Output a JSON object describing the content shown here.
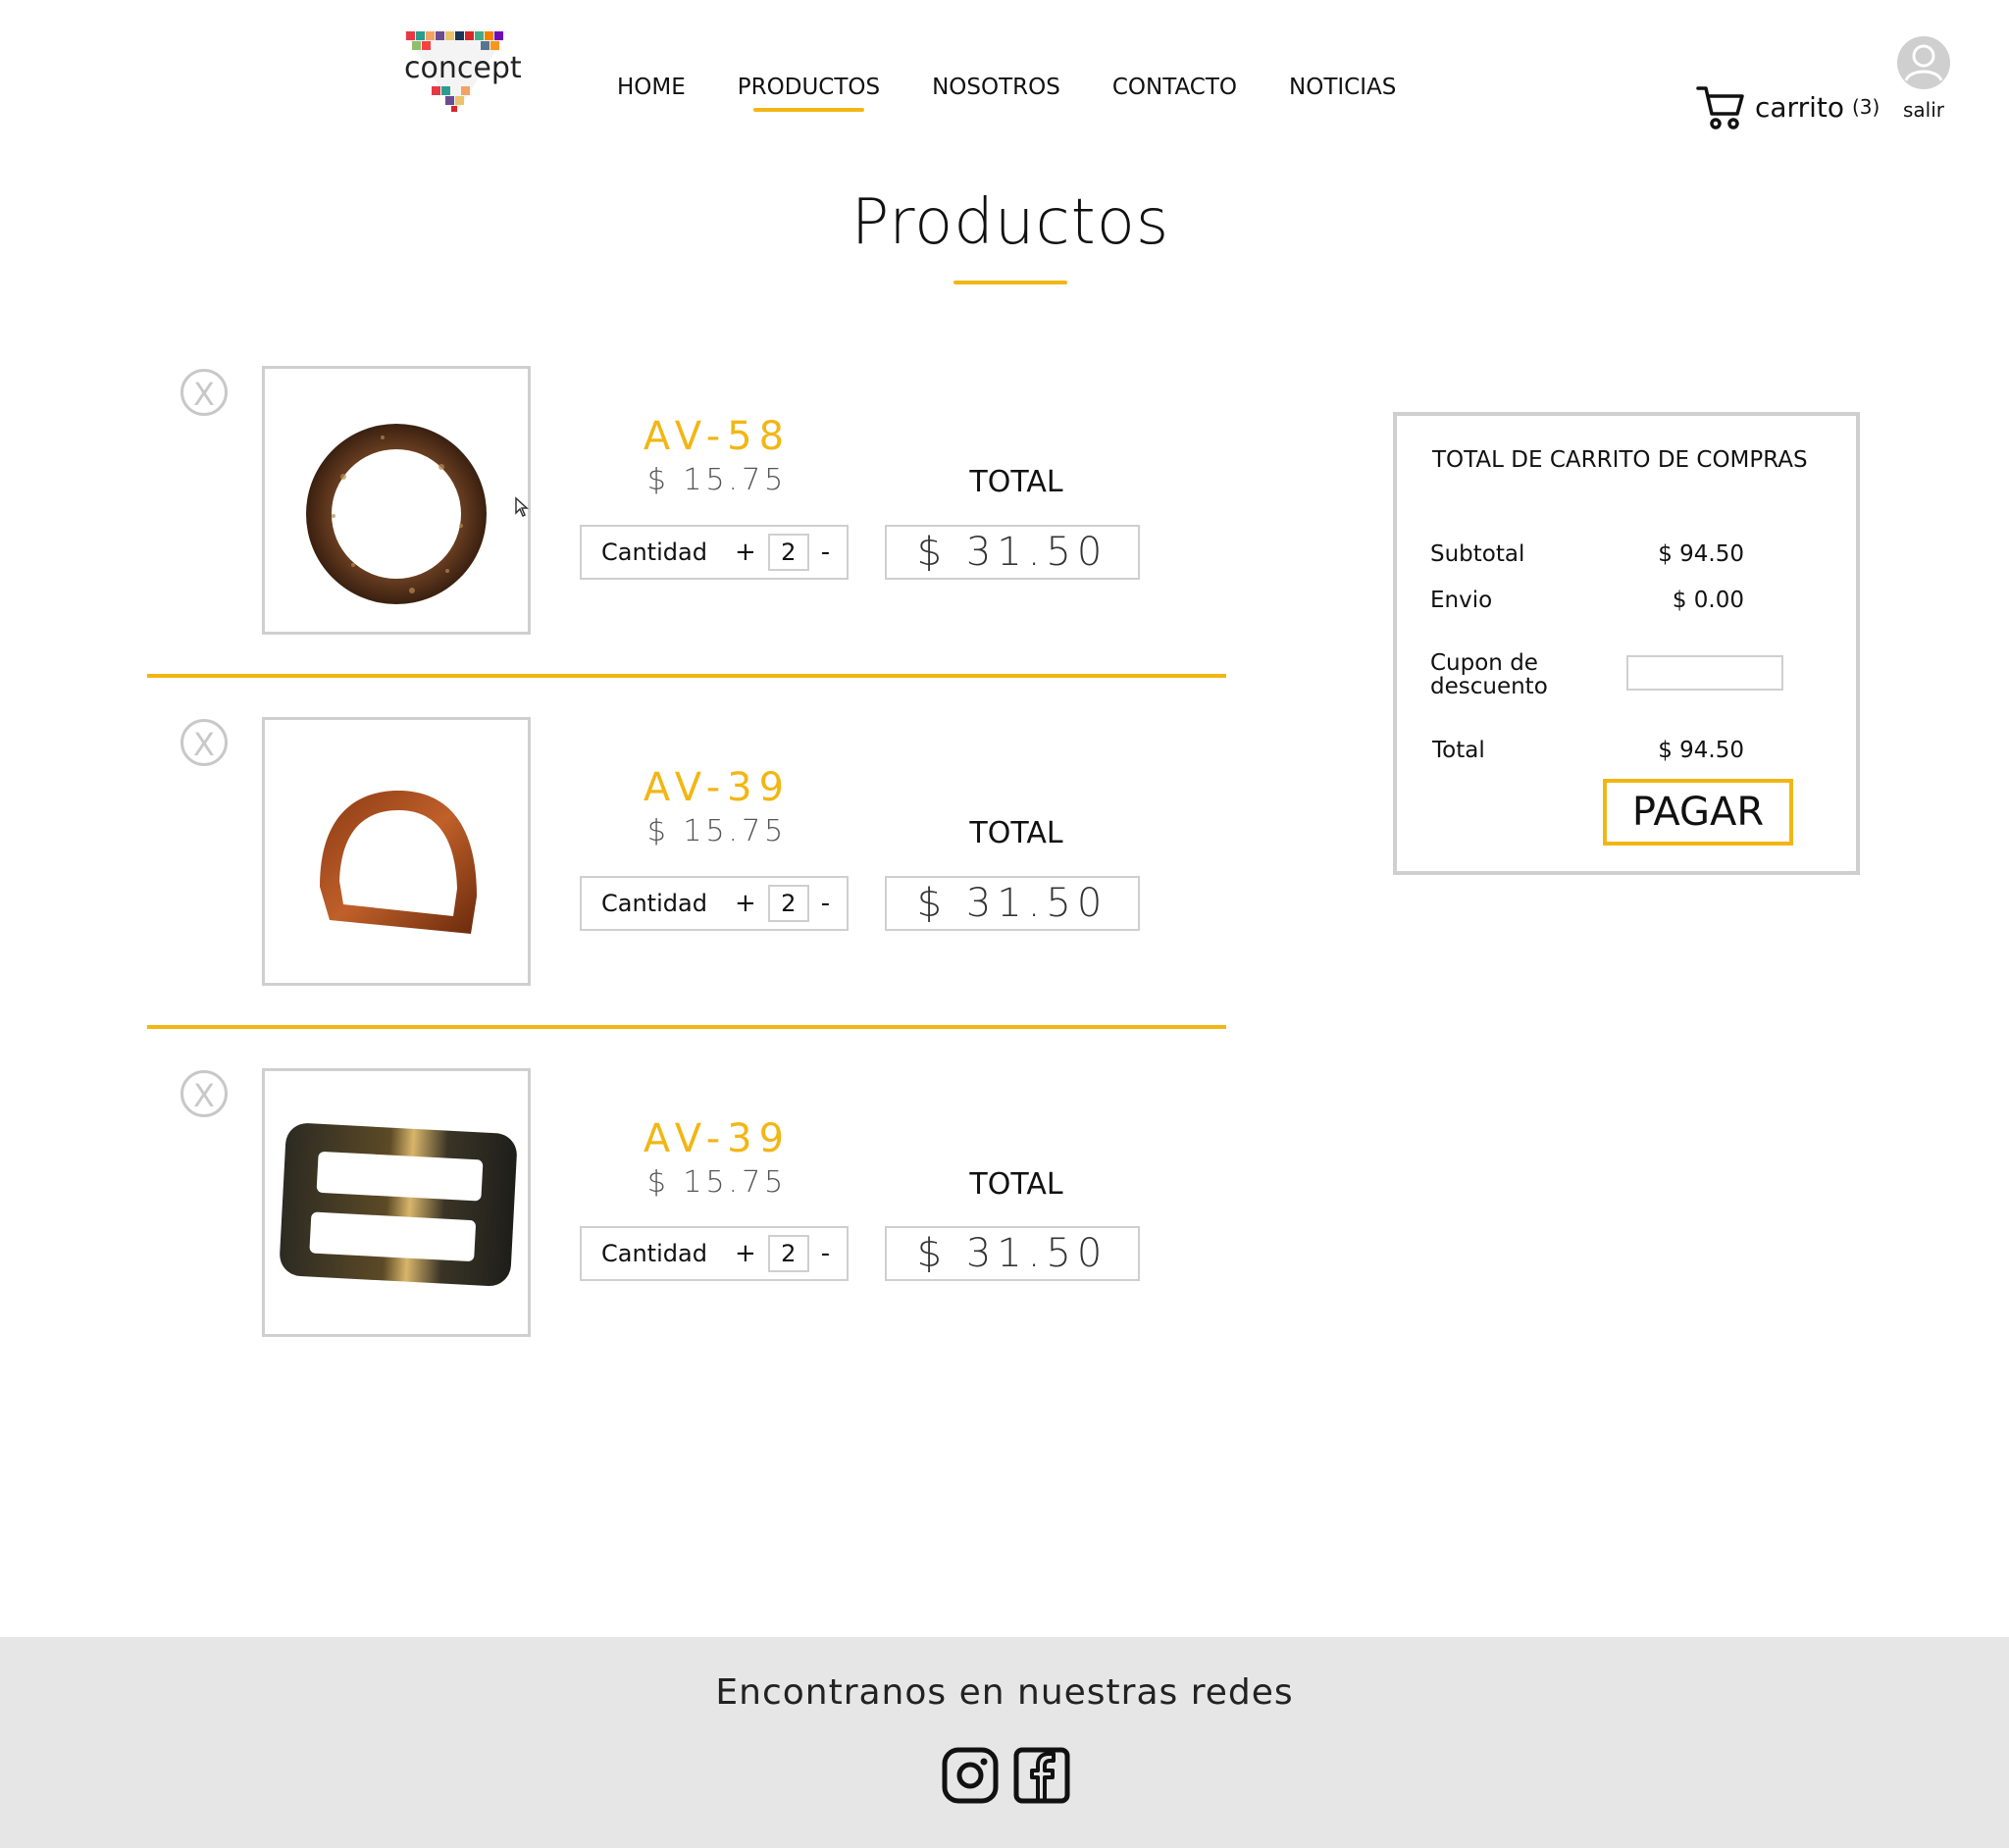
{
  "brand": {
    "logo_text": "concept"
  },
  "nav": {
    "items": [
      "HOME",
      "PRODUCTOS",
      "NOSOTROS",
      "CONTACTO",
      "NOTICIAS"
    ],
    "active_index": 1
  },
  "header": {
    "cart_label": "carrito",
    "cart_count": "(3)",
    "user_label": "salir"
  },
  "page": {
    "title": "Productos"
  },
  "cart_items": [
    {
      "remove": "X",
      "name": "AV-58",
      "price": "$ 15.75",
      "total_label": "TOTAL",
      "qty_label": "Cantidad",
      "plus": "+",
      "qty": "2",
      "minus": "-",
      "line_total": "$ 31.50",
      "image": "brown-ring-buckle"
    },
    {
      "remove": "X",
      "name": "AV-39",
      "price": "$ 15.75",
      "total_label": "TOTAL",
      "qty_label": "Cantidad",
      "plus": "+",
      "qty": "2",
      "minus": "-",
      "line_total": "$ 31.50",
      "image": "d-ring-buckle"
    },
    {
      "remove": "X",
      "name": "AV-39",
      "price": "$ 15.75",
      "total_label": "TOTAL",
      "qty_label": "Cantidad",
      "plus": "+",
      "qty": "2",
      "minus": "-",
      "line_total": "$ 31.50",
      "image": "rectangular-slide-buckle"
    }
  ],
  "summary": {
    "title": "TOTAL DE CARRITO DE COMPRAS",
    "subtotal_label": "Subtotal",
    "subtotal_value": "$ 94.50",
    "shipping_label": "Envio",
    "shipping_value": "$ 0.00",
    "coupon_label_line1": "Cupon de",
    "coupon_label_line2": "descuento",
    "coupon_value": "",
    "total_label": "Total",
    "total_value": "$ 94.50",
    "pay_button": "PAGAR"
  },
  "footer": {
    "title": "Encontranos en nuestras redes",
    "icons": [
      "instagram-icon",
      "facebook-icon"
    ]
  },
  "colors": {
    "accent": "#f2b614",
    "border": "#cfcfcf",
    "footer_bg": "#e6e6e6"
  }
}
